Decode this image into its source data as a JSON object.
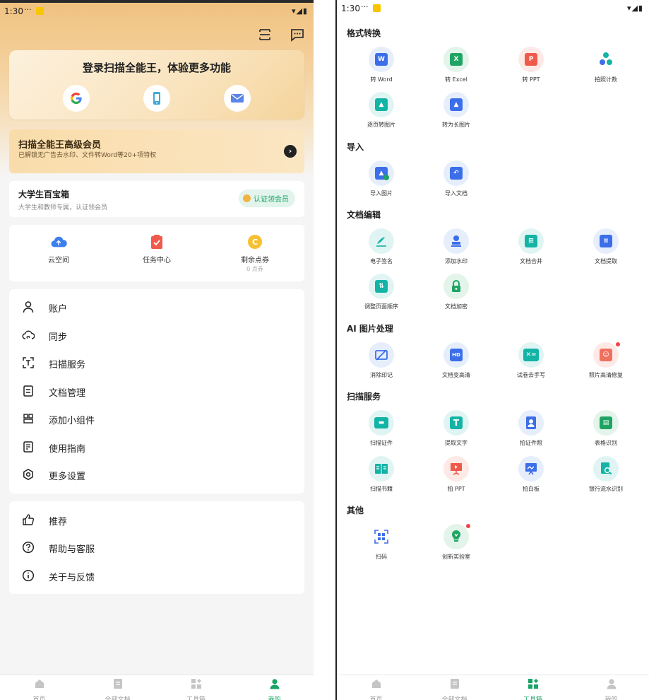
{
  "status_bar": {
    "time": "1:30",
    "dots": "···",
    "signal": "▾◢▮"
  },
  "left": {
    "login": {
      "title": "登录扫描全能王，体验更多功能"
    },
    "vip": {
      "title": "扫描全能王高级会员",
      "subtitle": "已解锁无广告去水印、文件转Word等20+项特权"
    },
    "student": {
      "title": "大学生百宝箱",
      "subtitle": "大学生和教师专属，认证领会员",
      "badge": "认证领会员"
    },
    "quick": [
      {
        "label": "云空间",
        "sub": ""
      },
      {
        "label": "任务中心",
        "sub": ""
      },
      {
        "label": "剩余点券",
        "sub": "0 点券"
      }
    ],
    "menu1": [
      {
        "label": "账户"
      },
      {
        "label": "同步"
      },
      {
        "label": "扫描服务"
      },
      {
        "label": "文档管理"
      },
      {
        "label": "添加小组件"
      },
      {
        "label": "使用指南"
      },
      {
        "label": "更多设置"
      }
    ],
    "menu2": [
      {
        "label": "推荐"
      },
      {
        "label": "帮助与客服"
      },
      {
        "label": "关于与反馈"
      }
    ]
  },
  "tabs": [
    "首页",
    "全部文档",
    "工具箱",
    "我的"
  ],
  "right": {
    "sections": {
      "convert": "格式转换",
      "import": "导入",
      "edit": "文档编辑",
      "ai": "AI 图片处理",
      "scan": "扫描服务",
      "other": "其他"
    },
    "convert": [
      "转 Word",
      "转 Excel",
      "转 PPT",
      "拍照计数",
      "逐页转图片",
      "转为长图片"
    ],
    "import": [
      "导入图片",
      "导入文档"
    ],
    "edit": [
      "电子签名",
      "添加水印",
      "文档合并",
      "文档提取",
      "调整页面顺序",
      "文档加密"
    ],
    "ai": [
      "消除印记",
      "文档变高清",
      "试卷去手写",
      "照片高清修复"
    ],
    "scan": [
      "扫描证件",
      "提取文字",
      "拍证件照",
      "表格识别",
      "扫描书籍",
      "拍 PPT",
      "拍白板",
      "银行流水识别"
    ],
    "other": [
      "扫码",
      "创新实验室"
    ]
  },
  "colors": {
    "accent": "#19a466",
    "blue": "#3b6ee8",
    "red": "#f05a4a",
    "teal": "#13b3a5",
    "badge_dot": "#f0454a"
  }
}
